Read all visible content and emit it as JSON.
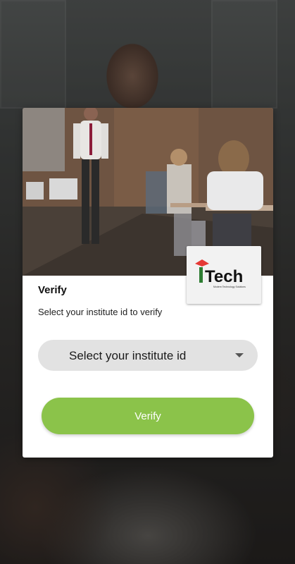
{
  "dialog": {
    "title": "Verify",
    "subtitle": "Select your institute id to verify",
    "select_placeholder": "Select your institute id",
    "verify_label": "Verify"
  },
  "logo": {
    "brand": "Tech",
    "tagline": "Modern Technology Solutions"
  },
  "colors": {
    "accent_green": "#8bc34a",
    "logo_red": "#e53935",
    "logo_green": "#2e7d32"
  }
}
